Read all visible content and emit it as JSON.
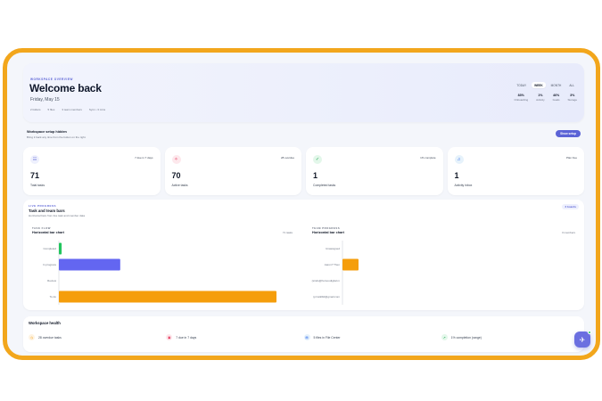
{
  "hero": {
    "eyebrow": "WORKSPACE OVERVIEW",
    "title": "Welcome back",
    "date": "Friday, May 15",
    "meta": [
      "2 folders",
      "5 files",
      "3 team members",
      "Sync • 3 mins"
    ],
    "ranges": [
      {
        "label": "TODAY",
        "active": false
      },
      {
        "label": "WEEK",
        "active": true
      },
      {
        "label": "MONTH",
        "active": false
      },
      {
        "label": "ALL",
        "active": false
      }
    ],
    "stats": [
      {
        "value": "83%",
        "label": "Onboarding"
      },
      {
        "value": "1%",
        "label": "Activity"
      },
      {
        "value": "46%",
        "label": "Goals"
      },
      {
        "value": "3%",
        "label": "Storage"
      }
    ]
  },
  "banner": {
    "title": "Workspace setup hidden",
    "subtitle": "Bring it back any time from the button on the right.",
    "button": "Show setup"
  },
  "cards": [
    {
      "icon": "list-icon",
      "glyph": "☷",
      "icon_bg": "#eef0fd",
      "icon_color": "#5b63d6",
      "note": "7 due in 7 days",
      "value": "71",
      "label": "Total tasks"
    },
    {
      "icon": "sparkle-icon",
      "glyph": "✧",
      "icon_bg": "#fde8ec",
      "icon_color": "#e11d48",
      "note": "28 overdue",
      "value": "70",
      "label": "Active tasks"
    },
    {
      "icon": "check-icon",
      "glyph": "✓",
      "icon_bg": "#e3f7ea",
      "icon_color": "#16a34a",
      "note": "1% complete",
      "value": "1",
      "label": "Completed tasks"
    },
    {
      "icon": "bell-icon",
      "glyph": "♫",
      "icon_bg": "#e6f2fb",
      "icon_color": "#2563eb",
      "note": "Plan free",
      "value": "1",
      "label": "Activity inbox"
    }
  ],
  "panel": {
    "eyebrow": "LIVE PROGRESS",
    "title": "Task and team bars",
    "subtitle": "Horizontal bars from live task and member data",
    "badge": "2 boards"
  },
  "chart_data": [
    {
      "type": "bar",
      "orientation": "horizontal",
      "eyebrow": "TASK FLOW",
      "title": "Horizontal bar chart",
      "count": "71 tasks",
      "categories": [
        "Completed",
        "In progress",
        "Review",
        "To do"
      ],
      "values": [
        1,
        22,
        0,
        78
      ],
      "colors": [
        "#22c55e",
        "#6366f1",
        "#9ca3af",
        "#f59e0b"
      ],
      "xlim": [
        0,
        78
      ]
    },
    {
      "type": "bar",
      "orientation": "horizontal",
      "eyebrow": "TEAM PROGRESS",
      "title": "Horizontal bar chart",
      "count": "3 members",
      "categories": [
        "Unassigned",
        "Aaron? Then",
        "(sinds@hursoudigital.m",
        "(prnsikl9d@gmail.com"
      ],
      "values": [
        0,
        1,
        0,
        0
      ],
      "colors": [
        "#f59e0b",
        "#f59e0b",
        "#f59e0b",
        "#f59e0b"
      ],
      "xlim": [
        0,
        1
      ]
    }
  ],
  "health": {
    "title": "Workspace health",
    "items": [
      {
        "icon": "clock-icon",
        "glyph": "◷",
        "bg": "#fef3e2",
        "color": "#f59e0b",
        "label": "28 overdue tasks"
      },
      {
        "icon": "calendar-icon",
        "glyph": "▣",
        "bg": "#fde8ec",
        "color": "#e11d48",
        "label": "7 due in 7 days"
      },
      {
        "icon": "file-icon",
        "glyph": "▤",
        "bg": "#e6f2fb",
        "color": "#2563eb",
        "label": "5 files in File Center"
      },
      {
        "icon": "trend-icon",
        "glyph": "↗",
        "bg": "#e3f7ea",
        "color": "#16a34a",
        "label": "1% completion (range)"
      }
    ]
  },
  "fab": {
    "icon": "rocket-icon",
    "glyph": "✈"
  }
}
